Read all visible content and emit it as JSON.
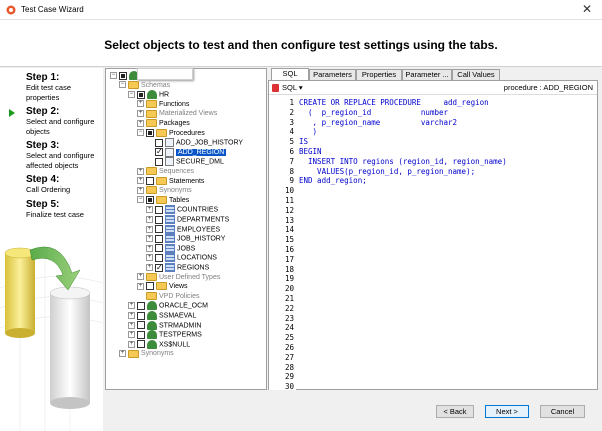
{
  "window": {
    "title": "Test Case Wizard",
    "close_glyph": "✕",
    "heading": "Select objects to test and then configure test settings using the tabs."
  },
  "steps": [
    {
      "title": "Step 1:",
      "desc": [
        "Edit test case",
        "properties"
      ]
    },
    {
      "title": "Step 2:",
      "desc": [
        "Select and configure",
        "objects"
      ]
    },
    {
      "title": "Step 3:",
      "desc": [
        "Select and configure",
        "affected objects"
      ]
    },
    {
      "title": "Step 4:",
      "desc": [
        "Call Ordering"
      ]
    },
    {
      "title": "Step 5:",
      "desc": [
        "Finalize test case"
      ]
    }
  ],
  "tree": {
    "connection_label": "",
    "items": [
      {
        "label": "",
        "indent": 0,
        "exp": "-",
        "check": "mixed",
        "icon": "connection"
      },
      {
        "label": "Schemas",
        "indent": 1,
        "exp": "-",
        "check": "",
        "icon": "folder",
        "grey": true
      },
      {
        "label": "HR",
        "indent": 2,
        "exp": "-",
        "check": "mixed",
        "icon": "user"
      },
      {
        "label": "Functions",
        "indent": 3,
        "exp": "+",
        "check": "",
        "icon": "folder"
      },
      {
        "label": "Materialized Views",
        "indent": 3,
        "exp": "+",
        "check": "",
        "icon": "folder",
        "grey": true
      },
      {
        "label": "Packages",
        "indent": 3,
        "exp": "+",
        "check": "",
        "icon": "folder"
      },
      {
        "label": "Procedures",
        "indent": 3,
        "exp": "-",
        "check": "mixed",
        "icon": "folder"
      },
      {
        "label": "ADD_JOB_HISTORY",
        "indent": 4,
        "exp": "",
        "check": "empty",
        "icon": "proc"
      },
      {
        "label": "ADD_REGION",
        "indent": 4,
        "exp": "",
        "check": "checked",
        "icon": "proc",
        "selected": true
      },
      {
        "label": "SECURE_DML",
        "indent": 4,
        "exp": "",
        "check": "empty",
        "icon": "proc"
      },
      {
        "label": "Sequences",
        "indent": 3,
        "exp": "+",
        "check": "",
        "icon": "folder",
        "grey": true
      },
      {
        "label": "Statements",
        "indent": 3,
        "exp": "+",
        "check": "empty",
        "icon": "folder"
      },
      {
        "label": "Synonyms",
        "indent": 3,
        "exp": "+",
        "check": "",
        "icon": "folder",
        "grey": true
      },
      {
        "label": "Tables",
        "indent": 3,
        "exp": "-",
        "check": "mixed",
        "icon": "folder"
      },
      {
        "label": "COUNTRIES",
        "indent": 4,
        "exp": "+",
        "check": "empty",
        "icon": "table"
      },
      {
        "label": "DEPARTMENTS",
        "indent": 4,
        "exp": "+",
        "check": "empty",
        "icon": "table"
      },
      {
        "label": "EMPLOYEES",
        "indent": 4,
        "exp": "+",
        "check": "empty",
        "icon": "table"
      },
      {
        "label": "JOB_HISTORY",
        "indent": 4,
        "exp": "+",
        "check": "empty",
        "icon": "table"
      },
      {
        "label": "JOBS",
        "indent": 4,
        "exp": "+",
        "check": "empty",
        "icon": "table"
      },
      {
        "label": "LOCATIONS",
        "indent": 4,
        "exp": "+",
        "check": "empty",
        "icon": "table"
      },
      {
        "label": "REGIONS",
        "indent": 4,
        "exp": "+",
        "check": "checked",
        "icon": "table"
      },
      {
        "label": "User Defined Types",
        "indent": 3,
        "exp": "+",
        "check": "",
        "icon": "folder",
        "grey": true
      },
      {
        "label": "Views",
        "indent": 3,
        "exp": "+",
        "check": "empty",
        "icon": "folder"
      },
      {
        "label": "VPD Policies",
        "indent": 3,
        "exp": "",
        "check": "",
        "icon": "folder",
        "grey": true
      },
      {
        "label": "ORACLE_OCM",
        "indent": 2,
        "exp": "+",
        "check": "empty",
        "icon": "user"
      },
      {
        "label": "SSMAEVAL",
        "indent": 2,
        "exp": "+",
        "check": "empty",
        "icon": "user"
      },
      {
        "label": "STRMADMIN",
        "indent": 2,
        "exp": "+",
        "check": "empty",
        "icon": "user"
      },
      {
        "label": "TESTPERMS",
        "indent": 2,
        "exp": "+",
        "check": "empty",
        "icon": "user"
      },
      {
        "label": "XS$NULL",
        "indent": 2,
        "exp": "+",
        "check": "empty",
        "icon": "user"
      },
      {
        "label": "Synonyms",
        "indent": 1,
        "exp": "+",
        "check": "",
        "icon": "folder",
        "grey": true
      }
    ]
  },
  "tabs": [
    "SQL",
    "Parameters",
    "Properties",
    "Parameter ...",
    "Call Values"
  ],
  "editor": {
    "mode_label": "SQL ▾",
    "object_label": "procedure : ADD_REGION",
    "lines": [
      "CREATE OR REPLACE PROCEDURE     add_region",
      "  (  p_region_id           number",
      "   , p_region_name         varchar2",
      "   )",
      "IS",
      "BEGIN",
      "  INSERT INTO regions (region_id, region_name)",
      "    VALUES(p_region_id, p_region_name);",
      "END add_region;"
    ],
    "line_count": 30
  },
  "buttons": {
    "back": "< Back",
    "next": "Next >",
    "cancel": "Cancel"
  },
  "colors": {
    "selection": "#0a56c8",
    "code": "#0000cc",
    "step_arrow": "#1a9a1a"
  }
}
